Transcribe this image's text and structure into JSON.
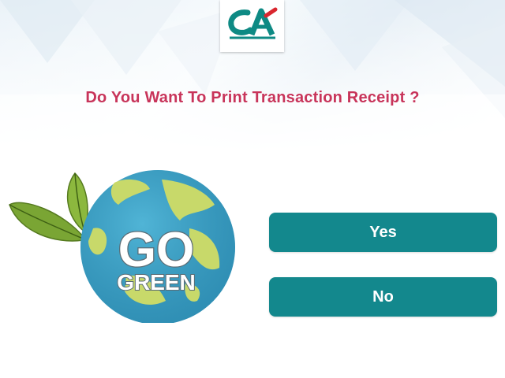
{
  "colors": {
    "question_text": "#c8345a",
    "button_bg": "#13888d",
    "button_text": "#ffffff",
    "brand_teal": "#0e8a84",
    "brand_red": "#d9262e",
    "globe_ocean": "#3aa3c9",
    "globe_land": "#c8d96a",
    "leaf_green": "#6f9a2c"
  },
  "header": {
    "logo_icon": "credit-agricole-logo",
    "question": "Do You Want To Print Transaction Receipt ?"
  },
  "illustration": {
    "icon": "go-green-globe",
    "line1": "GO",
    "line2": "GREEN"
  },
  "actions": {
    "yes_label": "Yes",
    "no_label": "No"
  }
}
